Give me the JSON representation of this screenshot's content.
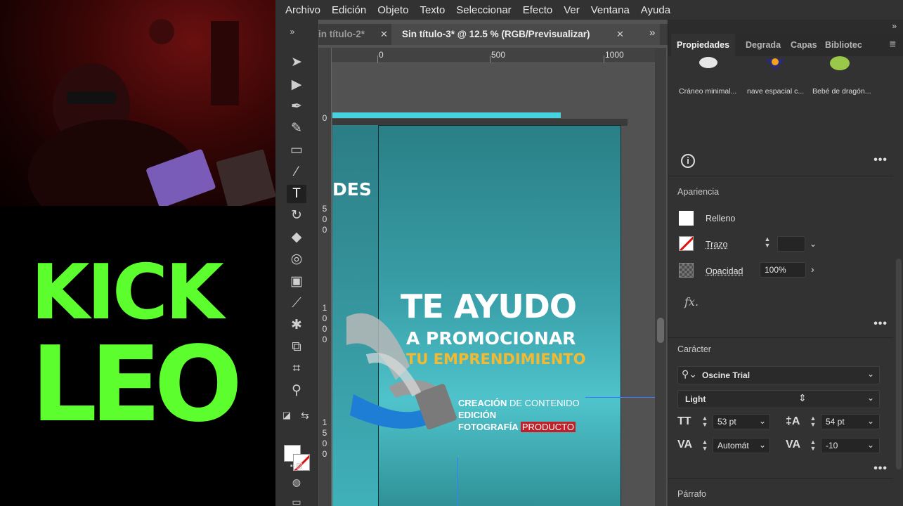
{
  "brand": {
    "line1": "KICK",
    "line2": "LEO",
    "color": "#5cff2d"
  },
  "menu": [
    "Archivo",
    "Edición",
    "Objeto",
    "Texto",
    "Seleccionar",
    "Efecto",
    "Ver",
    "Ventana",
    "Ayuda"
  ],
  "tabs": [
    {
      "label": "in título-2*",
      "active": false
    },
    {
      "label": "Sin título-3* @ 12.5 % (RGB/Previsualizar)",
      "active": true
    }
  ],
  "ruler": {
    "h": [
      "0",
      "500",
      "1000"
    ],
    "v0": "0",
    "v1": [
      "5",
      "0",
      "0"
    ],
    "v2": [
      "1",
      "0",
      "0",
      "0"
    ],
    "v3": [
      "1",
      "5",
      "0",
      "0"
    ]
  },
  "artwork": {
    "fragment": "DES",
    "headline": "TE AYUDO",
    "subline": "A PROMOCIONAR",
    "tagline": "TU EMPRENDIMIENTO",
    "services": {
      "l1_bold": "CREACIÓN",
      "l1_thin": " DE CONTENIDO",
      "l2": "EDICIÓN",
      "l3_bold": "FOTOGRAFÍA",
      "l3_highlight": "PRODUCTO"
    }
  },
  "panel": {
    "tabs": [
      "Propiedades",
      "Degrada",
      "Capas",
      "Bibliotec"
    ],
    "library": [
      "Cráneo minimal...",
      "nave espacial c...",
      "Bebé de dragón..."
    ],
    "appearance": {
      "title": "Apariencia",
      "fill": "Relleno",
      "stroke": "Trazo",
      "opacity_label": "Opacidad",
      "opacity_value": "100%"
    },
    "character": {
      "title": "Carácter",
      "font": "Oscine Trial",
      "style": "Light",
      "size": "53 pt",
      "leading": "54 pt",
      "kerning": "Automát",
      "tracking": "-10"
    },
    "paragraph_title": "Párrafo"
  },
  "tools": [
    "selection-icon",
    "direct-selection-icon",
    "pen-icon",
    "curvature-icon",
    "rectangle-icon",
    "paintbrush-icon",
    "type-icon",
    "rotate-icon",
    "eraser-icon",
    "shape-builder-icon",
    "gradient-icon",
    "eyedropper-icon",
    "puppet-warp-icon",
    "artboard-icon",
    "crop-icon",
    "zoom-icon"
  ]
}
